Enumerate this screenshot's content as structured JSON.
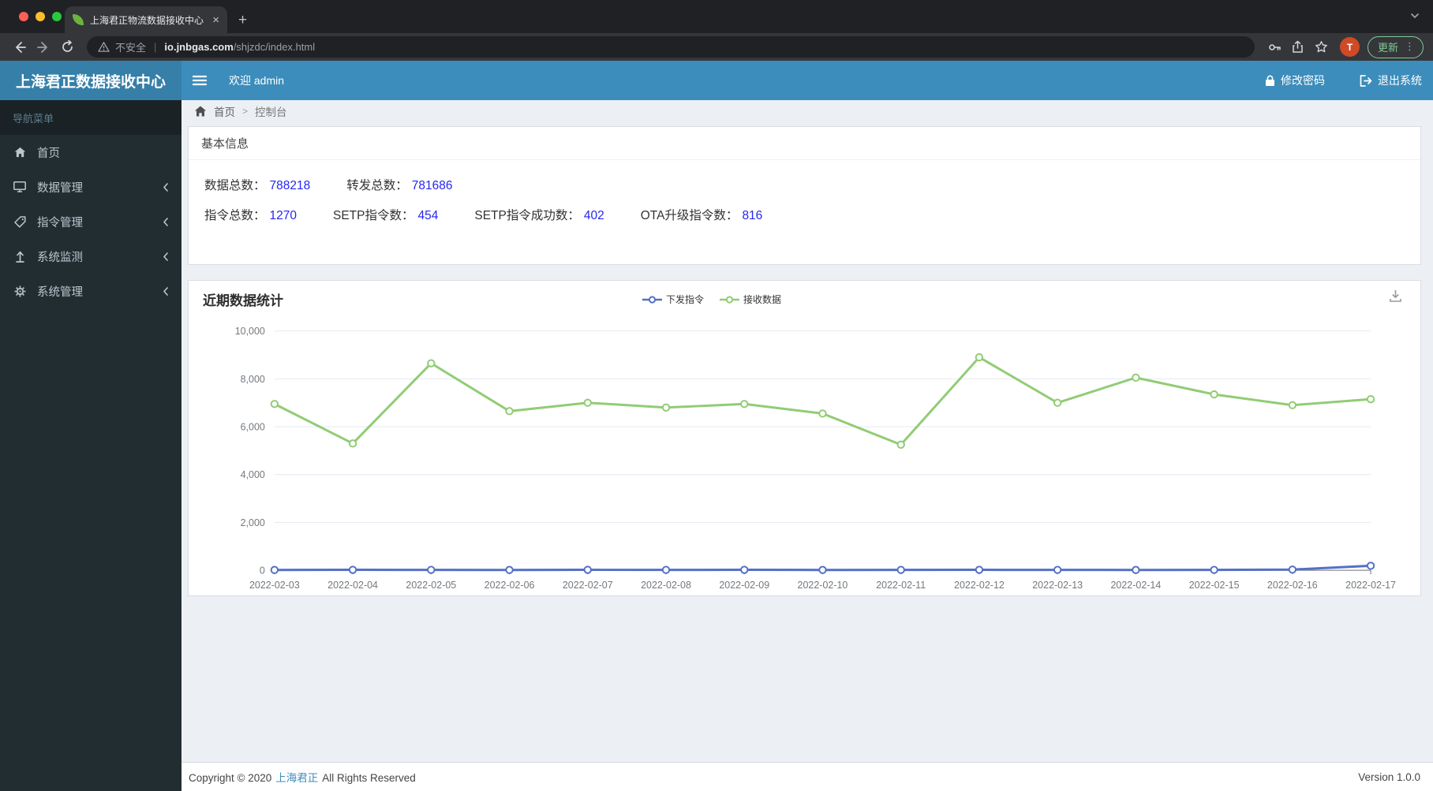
{
  "browser": {
    "tab_title": "上海君正物流数据接收中心",
    "url": {
      "security_label": "不安全",
      "host": "io.jnbgas.com",
      "path": "/shjzdc/index.html"
    },
    "profile_initial": "T",
    "update_button_label": "更新"
  },
  "icons": {
    "close": "×",
    "new_tab": "+",
    "menu_dots": "⋮",
    "url_divider": "|",
    "breadcrumb_separator": ">"
  },
  "app_header": {
    "brand": "上海君正数据接收中心",
    "welcome": "欢迎 admin",
    "change_password": "修改密码",
    "logout": "退出系统"
  },
  "sidebar": {
    "heading": "导航菜单",
    "items": [
      {
        "label": "首页",
        "icon": "home-icon",
        "has_submenu": false
      },
      {
        "label": "数据管理",
        "icon": "desktop-icon",
        "has_submenu": true
      },
      {
        "label": "指令管理",
        "icon": "tag-icon",
        "has_submenu": true
      },
      {
        "label": "系统监测",
        "icon": "upload-icon",
        "has_submenu": true
      },
      {
        "label": "系统管理",
        "icon": "gear-icon",
        "has_submenu": true
      }
    ]
  },
  "breadcrumb": {
    "home": "首页",
    "current": "控制台"
  },
  "info_panel": {
    "title": "基本信息",
    "rows": [
      [
        {
          "label": "数据总数：",
          "value": "788218"
        },
        {
          "label": "转发总数：",
          "value": "781686"
        }
      ],
      [
        {
          "label": "指令总数：",
          "value": "1270"
        },
        {
          "label": "SETP指令数：",
          "value": "454"
        },
        {
          "label": "SETP指令成功数：",
          "value": "402"
        },
        {
          "label": "OTA升级指令数：",
          "value": "816"
        }
      ]
    ],
    "value_color": "#2626f2"
  },
  "chart_data": {
    "type": "line",
    "title": "近期数据统计",
    "categories": [
      "2022-02-03",
      "2022-02-04",
      "2022-02-05",
      "2022-02-06",
      "2022-02-07",
      "2022-02-08",
      "2022-02-09",
      "2022-02-10",
      "2022-02-11",
      "2022-02-12",
      "2022-02-13",
      "2022-02-14",
      "2022-02-15",
      "2022-02-16",
      "2022-02-17"
    ],
    "series": [
      {
        "name": "下发指令",
        "color": "#5470c6",
        "values": [
          15,
          20,
          18,
          15,
          20,
          18,
          20,
          15,
          18,
          20,
          18,
          15,
          18,
          30,
          190
        ]
      },
      {
        "name": "接收数据",
        "color": "#91cc75",
        "values": [
          6950,
          5300,
          8650,
          6650,
          7000,
          6800,
          6950,
          6550,
          5250,
          8900,
          7000,
          8050,
          7350,
          6900,
          7150
        ]
      }
    ],
    "ylim": [
      0,
      10000
    ],
    "ytick_step": 2000,
    "ytick_labels": [
      "0",
      "2,000",
      "4,000",
      "6,000",
      "8,000",
      "10,000"
    ],
    "grid": true,
    "legend_position": "top-center",
    "xlabel": "",
    "ylabel": ""
  },
  "footer": {
    "copyright_prefix": "Copyright © 2020",
    "company_link": "上海君正",
    "copyright_suffix": "All Rights Reserved",
    "version": "Version 1.0.0"
  },
  "colors": {
    "navbar": "#3c8dbc",
    "logo_bg": "#367fa9",
    "sidebar_bg": "#222d32",
    "content_bg": "#ecf0f5",
    "series_blue": "#5470c6",
    "series_green": "#91cc75"
  }
}
